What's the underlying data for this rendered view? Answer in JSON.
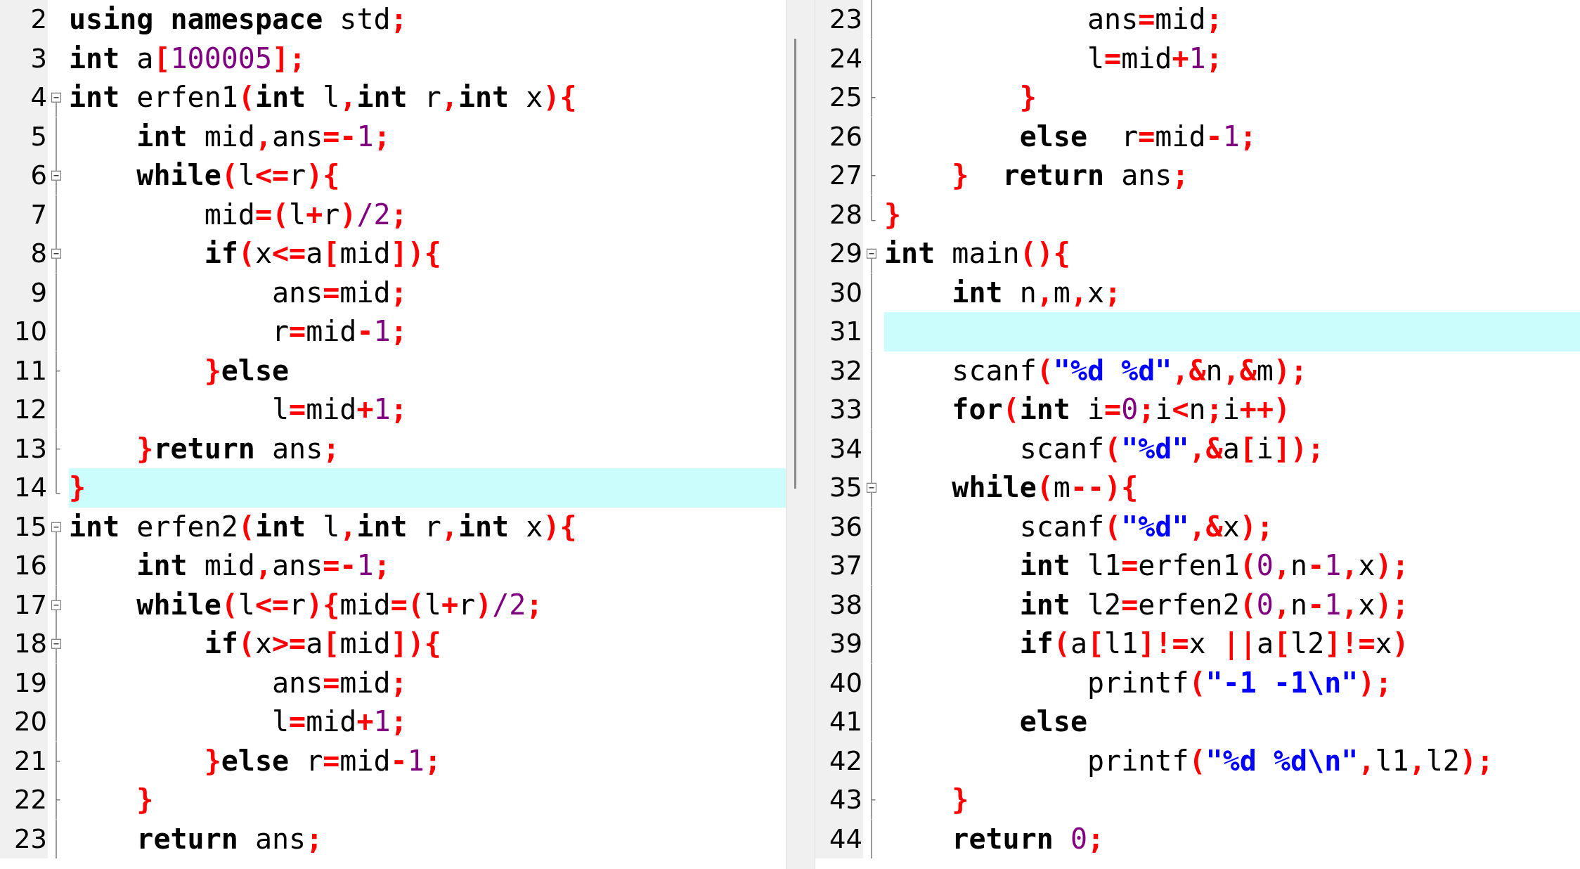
{
  "panes": [
    {
      "lines": [
        {
          "number": "2",
          "kind": "plain",
          "highlighted": false,
          "tokens": [
            {
              "kind": "kw",
              "text": "using namespace"
            },
            {
              "kind": "id",
              "text": " std"
            },
            {
              "kind": "op",
              "text": ";"
            }
          ]
        },
        {
          "number": "3",
          "kind": "plain",
          "highlighted": false,
          "tokens": [
            {
              "kind": "kw",
              "text": "int"
            },
            {
              "kind": "id",
              "text": " a"
            },
            {
              "kind": "op",
              "text": "["
            },
            {
              "kind": "num",
              "text": "100005"
            },
            {
              "kind": "op",
              "text": "];"
            }
          ]
        },
        {
          "number": "4",
          "kind": "start",
          "highlighted": false,
          "tokens": [
            {
              "kind": "kw",
              "text": "int"
            },
            {
              "kind": "id",
              "text": " erfen1"
            },
            {
              "kind": "op",
              "text": "("
            },
            {
              "kind": "kw",
              "text": "int"
            },
            {
              "kind": "id",
              "text": " l"
            },
            {
              "kind": "op",
              "text": ","
            },
            {
              "kind": "kw",
              "text": "int"
            },
            {
              "kind": "id",
              "text": " r"
            },
            {
              "kind": "op",
              "text": ","
            },
            {
              "kind": "kw",
              "text": "int"
            },
            {
              "kind": "id",
              "text": " x"
            },
            {
              "kind": "op",
              "text": "){"
            }
          ]
        },
        {
          "number": "5",
          "kind": "line",
          "highlighted": false,
          "tokens": [
            {
              "kind": "kw",
              "text": "    int"
            },
            {
              "kind": "id",
              "text": " mid"
            },
            {
              "kind": "op",
              "text": ","
            },
            {
              "kind": "id",
              "text": "ans"
            },
            {
              "kind": "op",
              "text": "=-"
            },
            {
              "kind": "num",
              "text": "1"
            },
            {
              "kind": "op",
              "text": ";"
            }
          ]
        },
        {
          "number": "6",
          "kind": "nested-start",
          "highlighted": false,
          "tokens": [
            {
              "kind": "kw",
              "text": "    while"
            },
            {
              "kind": "op",
              "text": "("
            },
            {
              "kind": "id",
              "text": "l"
            },
            {
              "kind": "op",
              "text": "<="
            },
            {
              "kind": "id",
              "text": "r"
            },
            {
              "kind": "op",
              "text": "){"
            }
          ]
        },
        {
          "number": "7",
          "kind": "line",
          "highlighted": false,
          "tokens": [
            {
              "kind": "id",
              "text": "        mid"
            },
            {
              "kind": "op",
              "text": "=("
            },
            {
              "kind": "id",
              "text": "l"
            },
            {
              "kind": "op",
              "text": "+"
            },
            {
              "kind": "id",
              "text": "r"
            },
            {
              "kind": "op",
              "text": ")"
            },
            {
              "kind": "num",
              "text": "/2"
            },
            {
              "kind": "op",
              "text": ";"
            }
          ]
        },
        {
          "number": "8",
          "kind": "nested-start",
          "highlighted": false,
          "tokens": [
            {
              "kind": "kw",
              "text": "        if"
            },
            {
              "kind": "op",
              "text": "("
            },
            {
              "kind": "id",
              "text": "x"
            },
            {
              "kind": "op",
              "text": "<="
            },
            {
              "kind": "id",
              "text": "a"
            },
            {
              "kind": "op",
              "text": "["
            },
            {
              "kind": "id",
              "text": "mid"
            },
            {
              "kind": "op",
              "text": "]){"
            }
          ]
        },
        {
          "number": "9",
          "kind": "line",
          "highlighted": false,
          "tokens": [
            {
              "kind": "id",
              "text": "            ans"
            },
            {
              "kind": "op",
              "text": "="
            },
            {
              "kind": "id",
              "text": "mid"
            },
            {
              "kind": "op",
              "text": ";"
            }
          ]
        },
        {
          "number": "10",
          "kind": "line",
          "highlighted": false,
          "tokens": [
            {
              "kind": "id",
              "text": "            r"
            },
            {
              "kind": "op",
              "text": "="
            },
            {
              "kind": "id",
              "text": "mid"
            },
            {
              "kind": "op",
              "text": "-"
            },
            {
              "kind": "num",
              "text": "1"
            },
            {
              "kind": "op",
              "text": ";"
            }
          ]
        },
        {
          "number": "11",
          "kind": "tick",
          "highlighted": false,
          "tokens": [
            {
              "kind": "op",
              "text": "        }"
            },
            {
              "kind": "kw",
              "text": "else"
            }
          ]
        },
        {
          "number": "12",
          "kind": "line",
          "highlighted": false,
          "tokens": [
            {
              "kind": "id",
              "text": "            l"
            },
            {
              "kind": "op",
              "text": "="
            },
            {
              "kind": "id",
              "text": "mid"
            },
            {
              "kind": "op",
              "text": "+"
            },
            {
              "kind": "num",
              "text": "1"
            },
            {
              "kind": "op",
              "text": ";"
            }
          ]
        },
        {
          "number": "13",
          "kind": "tick",
          "highlighted": false,
          "tokens": [
            {
              "kind": "op",
              "text": "    }"
            },
            {
              "kind": "kw",
              "text": "return"
            },
            {
              "kind": "id",
              "text": " ans"
            },
            {
              "kind": "op",
              "text": ";"
            }
          ]
        },
        {
          "number": "14",
          "kind": "end",
          "highlighted": true,
          "tokens": [
            {
              "kind": "op",
              "text": "}"
            }
          ]
        },
        {
          "number": "15",
          "kind": "start",
          "highlighted": false,
          "tokens": [
            {
              "kind": "kw",
              "text": "int"
            },
            {
              "kind": "id",
              "text": " erfen2"
            },
            {
              "kind": "op",
              "text": "("
            },
            {
              "kind": "kw",
              "text": "int"
            },
            {
              "kind": "id",
              "text": " l"
            },
            {
              "kind": "op",
              "text": ","
            },
            {
              "kind": "kw",
              "text": "int"
            },
            {
              "kind": "id",
              "text": " r"
            },
            {
              "kind": "op",
              "text": ","
            },
            {
              "kind": "kw",
              "text": "int"
            },
            {
              "kind": "id",
              "text": " x"
            },
            {
              "kind": "op",
              "text": "){"
            }
          ]
        },
        {
          "number": "16",
          "kind": "line",
          "highlighted": false,
          "tokens": [
            {
              "kind": "kw",
              "text": "    int"
            },
            {
              "kind": "id",
              "text": " mid"
            },
            {
              "kind": "op",
              "text": ","
            },
            {
              "kind": "id",
              "text": "ans"
            },
            {
              "kind": "op",
              "text": "=-"
            },
            {
              "kind": "num",
              "text": "1"
            },
            {
              "kind": "op",
              "text": ";"
            }
          ]
        },
        {
          "number": "17",
          "kind": "nested-start",
          "highlighted": false,
          "tokens": [
            {
              "kind": "kw",
              "text": "    while"
            },
            {
              "kind": "op",
              "text": "("
            },
            {
              "kind": "id",
              "text": "l"
            },
            {
              "kind": "op",
              "text": "<="
            },
            {
              "kind": "id",
              "text": "r"
            },
            {
              "kind": "op",
              "text": "){"
            },
            {
              "kind": "id",
              "text": "mid"
            },
            {
              "kind": "op",
              "text": "=("
            },
            {
              "kind": "id",
              "text": "l"
            },
            {
              "kind": "op",
              "text": "+"
            },
            {
              "kind": "id",
              "text": "r"
            },
            {
              "kind": "op",
              "text": ")"
            },
            {
              "kind": "num",
              "text": "/2"
            },
            {
              "kind": "op",
              "text": ";"
            }
          ]
        },
        {
          "number": "18",
          "kind": "nested-start",
          "highlighted": false,
          "tokens": [
            {
              "kind": "kw",
              "text": "        if"
            },
            {
              "kind": "op",
              "text": "("
            },
            {
              "kind": "id",
              "text": "x"
            },
            {
              "kind": "op",
              "text": ">="
            },
            {
              "kind": "id",
              "text": "a"
            },
            {
              "kind": "op",
              "text": "["
            },
            {
              "kind": "id",
              "text": "mid"
            },
            {
              "kind": "op",
              "text": "]){"
            }
          ]
        },
        {
          "number": "19",
          "kind": "line",
          "highlighted": false,
          "tokens": [
            {
              "kind": "id",
              "text": "            ans"
            },
            {
              "kind": "op",
              "text": "="
            },
            {
              "kind": "id",
              "text": "mid"
            },
            {
              "kind": "op",
              "text": ";"
            }
          ]
        },
        {
          "number": "20",
          "kind": "line",
          "highlighted": false,
          "tokens": [
            {
              "kind": "id",
              "text": "            l"
            },
            {
              "kind": "op",
              "text": "="
            },
            {
              "kind": "id",
              "text": "mid"
            },
            {
              "kind": "op",
              "text": "+"
            },
            {
              "kind": "num",
              "text": "1"
            },
            {
              "kind": "op",
              "text": ";"
            }
          ]
        },
        {
          "number": "21",
          "kind": "tick",
          "highlighted": false,
          "tokens": [
            {
              "kind": "op",
              "text": "        }"
            },
            {
              "kind": "kw",
              "text": "else"
            },
            {
              "kind": "id",
              "text": " r"
            },
            {
              "kind": "op",
              "text": "="
            },
            {
              "kind": "id",
              "text": "mid"
            },
            {
              "kind": "op",
              "text": "-"
            },
            {
              "kind": "num",
              "text": "1"
            },
            {
              "kind": "op",
              "text": ";"
            }
          ]
        },
        {
          "number": "22",
          "kind": "tick",
          "highlighted": false,
          "tokens": [
            {
              "kind": "op",
              "text": "    }"
            }
          ]
        },
        {
          "number": "23",
          "kind": "line",
          "highlighted": false,
          "tokens": [
            {
              "kind": "kw",
              "text": "    return"
            },
            {
              "kind": "id",
              "text": " ans"
            },
            {
              "kind": "op",
              "text": ";"
            }
          ]
        }
      ]
    },
    {
      "lines": [
        {
          "number": "23",
          "kind": "line",
          "highlighted": false,
          "tokens": [
            {
              "kind": "id",
              "text": "            ans"
            },
            {
              "kind": "op",
              "text": "="
            },
            {
              "kind": "id",
              "text": "mid"
            },
            {
              "kind": "op",
              "text": ";"
            }
          ]
        },
        {
          "number": "24",
          "kind": "line",
          "highlighted": false,
          "tokens": [
            {
              "kind": "id",
              "text": "            l"
            },
            {
              "kind": "op",
              "text": "="
            },
            {
              "kind": "id",
              "text": "mid"
            },
            {
              "kind": "op",
              "text": "+"
            },
            {
              "kind": "num",
              "text": "1"
            },
            {
              "kind": "op",
              "text": ";"
            }
          ]
        },
        {
          "number": "25",
          "kind": "tick",
          "highlighted": false,
          "tokens": [
            {
              "kind": "op",
              "text": "        }"
            }
          ]
        },
        {
          "number": "26",
          "kind": "line",
          "highlighted": false,
          "tokens": [
            {
              "kind": "kw",
              "text": "        else"
            },
            {
              "kind": "id",
              "text": "  r"
            },
            {
              "kind": "op",
              "text": "="
            },
            {
              "kind": "id",
              "text": "mid"
            },
            {
              "kind": "op",
              "text": "-"
            },
            {
              "kind": "num",
              "text": "1"
            },
            {
              "kind": "op",
              "text": ";"
            }
          ]
        },
        {
          "number": "27",
          "kind": "tick",
          "highlighted": false,
          "tokens": [
            {
              "kind": "op",
              "text": "    }"
            },
            {
              "kind": "kw",
              "text": "  return"
            },
            {
              "kind": "id",
              "text": " ans"
            },
            {
              "kind": "op",
              "text": ";"
            }
          ]
        },
        {
          "number": "28",
          "kind": "end",
          "highlighted": false,
          "tokens": [
            {
              "kind": "op",
              "text": "}"
            }
          ]
        },
        {
          "number": "29",
          "kind": "start",
          "highlighted": false,
          "tokens": [
            {
              "kind": "kw",
              "text": "int"
            },
            {
              "kind": "id",
              "text": " main"
            },
            {
              "kind": "op",
              "text": "(){"
            }
          ]
        },
        {
          "number": "30",
          "kind": "line",
          "highlighted": false,
          "tokens": [
            {
              "kind": "kw",
              "text": "    int"
            },
            {
              "kind": "id",
              "text": " n"
            },
            {
              "kind": "op",
              "text": ","
            },
            {
              "kind": "id",
              "text": "m"
            },
            {
              "kind": "op",
              "text": ","
            },
            {
              "kind": "id",
              "text": "x"
            },
            {
              "kind": "op",
              "text": ";"
            }
          ]
        },
        {
          "number": "31",
          "kind": "line",
          "highlighted": true
        },
        {
          "number": "32",
          "kind": "line",
          "highlighted": false,
          "tokens": [
            {
              "kind": "id",
              "text": "    scanf"
            },
            {
              "kind": "op",
              "text": "("
            },
            {
              "kind": "str",
              "text": "\"%d %d\""
            },
            {
              "kind": "op",
              "text": ",&"
            },
            {
              "kind": "id",
              "text": "n"
            },
            {
              "kind": "op",
              "text": ",&"
            },
            {
              "kind": "id",
              "text": "m"
            },
            {
              "kind": "op",
              "text": ");"
            }
          ]
        },
        {
          "number": "33",
          "kind": "line",
          "highlighted": false,
          "tokens": [
            {
              "kind": "kw",
              "text": "    for"
            },
            {
              "kind": "op",
              "text": "("
            },
            {
              "kind": "kw",
              "text": "int"
            },
            {
              "kind": "id",
              "text": " i"
            },
            {
              "kind": "op",
              "text": "="
            },
            {
              "kind": "num",
              "text": "0"
            },
            {
              "kind": "op",
              "text": ";"
            },
            {
              "kind": "id",
              "text": "i"
            },
            {
              "kind": "op",
              "text": "<"
            },
            {
              "kind": "id",
              "text": "n"
            },
            {
              "kind": "op",
              "text": ";"
            },
            {
              "kind": "id",
              "text": "i"
            },
            {
              "kind": "op",
              "text": "++)"
            }
          ]
        },
        {
          "number": "34",
          "kind": "line",
          "highlighted": false,
          "tokens": [
            {
              "kind": "id",
              "text": "        scanf"
            },
            {
              "kind": "op",
              "text": "("
            },
            {
              "kind": "str",
              "text": "\"%d\""
            },
            {
              "kind": "op",
              "text": ",&"
            },
            {
              "kind": "id",
              "text": "a"
            },
            {
              "kind": "op",
              "text": "["
            },
            {
              "kind": "id",
              "text": "i"
            },
            {
              "kind": "op",
              "text": "]);"
            }
          ]
        },
        {
          "number": "35",
          "kind": "nested-start",
          "highlighted": false,
          "tokens": [
            {
              "kind": "kw",
              "text": "    while"
            },
            {
              "kind": "op",
              "text": "("
            },
            {
              "kind": "id",
              "text": "m"
            },
            {
              "kind": "op",
              "text": "--){"
            }
          ]
        },
        {
          "number": "36",
          "kind": "line",
          "highlighted": false,
          "tokens": [
            {
              "kind": "id",
              "text": "        scanf"
            },
            {
              "kind": "op",
              "text": "("
            },
            {
              "kind": "str",
              "text": "\"%d\""
            },
            {
              "kind": "op",
              "text": ",&"
            },
            {
              "kind": "id",
              "text": "x"
            },
            {
              "kind": "op",
              "text": ");"
            }
          ]
        },
        {
          "number": "37",
          "kind": "line",
          "highlighted": false,
          "tokens": [
            {
              "kind": "kw",
              "text": "        int"
            },
            {
              "kind": "id",
              "text": " l1"
            },
            {
              "kind": "op",
              "text": "="
            },
            {
              "kind": "id",
              "text": "erfen1"
            },
            {
              "kind": "op",
              "text": "("
            },
            {
              "kind": "num",
              "text": "0"
            },
            {
              "kind": "op",
              "text": ","
            },
            {
              "kind": "id",
              "text": "n"
            },
            {
              "kind": "op",
              "text": "-"
            },
            {
              "kind": "num",
              "text": "1"
            },
            {
              "kind": "op",
              "text": ","
            },
            {
              "kind": "id",
              "text": "x"
            },
            {
              "kind": "op",
              "text": ");"
            }
          ]
        },
        {
          "number": "38",
          "kind": "line",
          "highlighted": false,
          "tokens": [
            {
              "kind": "kw",
              "text": "        int"
            },
            {
              "kind": "id",
              "text": " l2"
            },
            {
              "kind": "op",
              "text": "="
            },
            {
              "kind": "id",
              "text": "erfen2"
            },
            {
              "kind": "op",
              "text": "("
            },
            {
              "kind": "num",
              "text": "0"
            },
            {
              "kind": "op",
              "text": ","
            },
            {
              "kind": "id",
              "text": "n"
            },
            {
              "kind": "op",
              "text": "-"
            },
            {
              "kind": "num",
              "text": "1"
            },
            {
              "kind": "op",
              "text": ","
            },
            {
              "kind": "id",
              "text": "x"
            },
            {
              "kind": "op",
              "text": ");"
            }
          ]
        },
        {
          "number": "39",
          "kind": "line",
          "highlighted": false,
          "tokens": [
            {
              "kind": "kw",
              "text": "        if"
            },
            {
              "kind": "op",
              "text": "("
            },
            {
              "kind": "id",
              "text": "a"
            },
            {
              "kind": "op",
              "text": "["
            },
            {
              "kind": "id",
              "text": "l1"
            },
            {
              "kind": "op",
              "text": "]!="
            },
            {
              "kind": "id",
              "text": "x "
            },
            {
              "kind": "op",
              "text": "||"
            },
            {
              "kind": "id",
              "text": "a"
            },
            {
              "kind": "op",
              "text": "["
            },
            {
              "kind": "id",
              "text": "l2"
            },
            {
              "kind": "op",
              "text": "]!="
            },
            {
              "kind": "id",
              "text": "x"
            },
            {
              "kind": "op",
              "text": ")"
            }
          ]
        },
        {
          "number": "40",
          "kind": "line",
          "highlighted": false,
          "tokens": [
            {
              "kind": "id",
              "text": "            printf"
            },
            {
              "kind": "op",
              "text": "("
            },
            {
              "kind": "str",
              "text": "\"-1 -1\\n\""
            },
            {
              "kind": "op",
              "text": ");"
            }
          ]
        },
        {
          "number": "41",
          "kind": "line",
          "highlighted": false,
          "tokens": [
            {
              "kind": "kw",
              "text": "        else"
            }
          ]
        },
        {
          "number": "42",
          "kind": "line",
          "highlighted": false,
          "tokens": [
            {
              "kind": "id",
              "text": "            printf"
            },
            {
              "kind": "op",
              "text": "("
            },
            {
              "kind": "str",
              "text": "\"%d %d\\n\""
            },
            {
              "kind": "op",
              "text": ","
            },
            {
              "kind": "id",
              "text": "l1"
            },
            {
              "kind": "op",
              "text": ","
            },
            {
              "kind": "id",
              "text": "l2"
            },
            {
              "kind": "op",
              "text": ");"
            }
          ]
        },
        {
          "number": "43",
          "kind": "tick",
          "highlighted": false,
          "tokens": [
            {
              "kind": "op",
              "text": "    }"
            }
          ]
        },
        {
          "number": "44",
          "kind": "line",
          "highlighted": false,
          "tokens": [
            {
              "kind": "kw",
              "text": "    return "
            },
            {
              "kind": "num",
              "text": "0"
            },
            {
              "kind": "op",
              "text": ";"
            }
          ]
        }
      ]
    }
  ]
}
